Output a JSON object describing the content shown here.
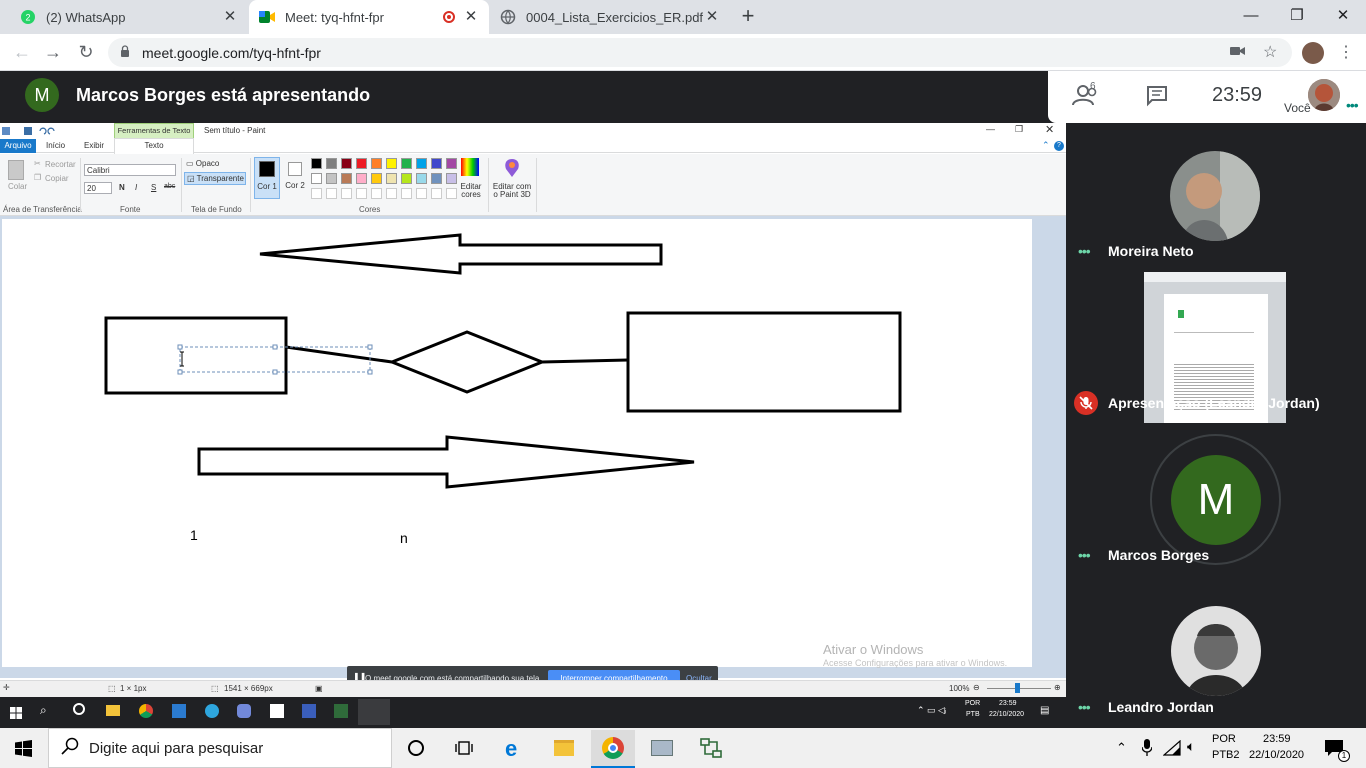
{
  "browser": {
    "tabs": [
      {
        "title": "(2) WhatsApp"
      },
      {
        "title": "Meet: tyq-hfnt-fpr"
      },
      {
        "title": "0004_Lista_Exercicios_ER.pdf"
      }
    ],
    "new_tab": "+",
    "url": "meet.google.com/tyq-hfnt-fpr"
  },
  "meet": {
    "presenter_initial": "M",
    "presenter_text": "Marcos Borges está apresentando",
    "people_count": "6",
    "time": "23:59",
    "you_label": "Você",
    "participants": [
      {
        "name": "Moreira Neto"
      },
      {
        "name": "Apresentação (Leandro Jordan)"
      },
      {
        "name": "Marcos Borges",
        "initial": "M"
      },
      {
        "name": "Leandro Jordan"
      }
    ],
    "share_banner": {
      "text": "O meet.google.com está compartilhando sua tela.",
      "stop_label": "Interromper compartilhamento",
      "hide_label": "Ocultar"
    }
  },
  "paint": {
    "context_tab": "Ferramentas de Texto",
    "title": "Sem título - Paint",
    "menu": [
      "Arquivo",
      "Início",
      "Exibir",
      "Texto"
    ],
    "clipboard": {
      "paste": "Colar",
      "cut": "Recortar",
      "copy": "Copiar",
      "group": "Área de Transferência"
    },
    "font": {
      "name": "Calibri",
      "size": "20",
      "bold": "N",
      "italic": "I",
      "underline": "S",
      "strike": "abc",
      "group": "Fonte"
    },
    "background": {
      "opaque": "Opaco",
      "transparent": "Transparente",
      "group": "Tela de Fundo"
    },
    "colors": {
      "color1": "Cor 1",
      "color2": "Cor 2",
      "edit": "Editar cores",
      "group": "Cores",
      "paint3d": "Editar com o Paint 3D"
    },
    "canvas_labels": {
      "one": "1",
      "n": "n"
    },
    "watermark": {
      "line1": "Ativar o Windows",
      "line2": "Acesse Configurações para ativar o Windows."
    },
    "status": {
      "selection": "1 × 1px",
      "size": "1541 × 669px",
      "zoom": "100%"
    }
  },
  "inner_taskbar": {
    "lang1": "POR",
    "lang2": "PTB",
    "time": "23:59",
    "date": "22/10/2020"
  },
  "taskbar": {
    "search_placeholder": "Digite aqui para pesquisar",
    "lang1": "POR",
    "lang2": "PTB2",
    "time": "23:59",
    "date": "22/10/2020",
    "notif_count": "1"
  },
  "palette": [
    "#000000",
    "#7f7f7f",
    "#880015",
    "#ed1c24",
    "#ff7f27",
    "#fff200",
    "#22b14c",
    "#00a2e8",
    "#3f48cc",
    "#a349a4",
    "#ffffff",
    "#c3c3c3",
    "#b97a57",
    "#ffaec9",
    "#ffc90e",
    "#efe4b0",
    "#b5e61d",
    "#99d9ea",
    "#7092be",
    "#c8bfe7"
  ]
}
